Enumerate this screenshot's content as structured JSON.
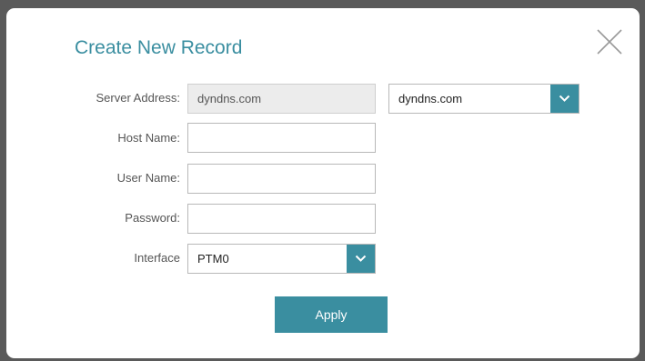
{
  "dialog": {
    "title": "Create New Record",
    "close_icon": "close-icon"
  },
  "form": {
    "server_address": {
      "label": "Server Address:",
      "value": "dyndns.com",
      "select_value": "dyndns.com"
    },
    "host_name": {
      "label": "Host Name:",
      "value": ""
    },
    "user_name": {
      "label": "User Name:",
      "value": ""
    },
    "password": {
      "label": "Password:",
      "value": ""
    },
    "interface": {
      "label": "Interface",
      "select_value": "PTM0"
    },
    "apply_label": "Apply"
  },
  "colors": {
    "accent": "#3a8ea0",
    "backdrop": "#5a5a5a"
  }
}
